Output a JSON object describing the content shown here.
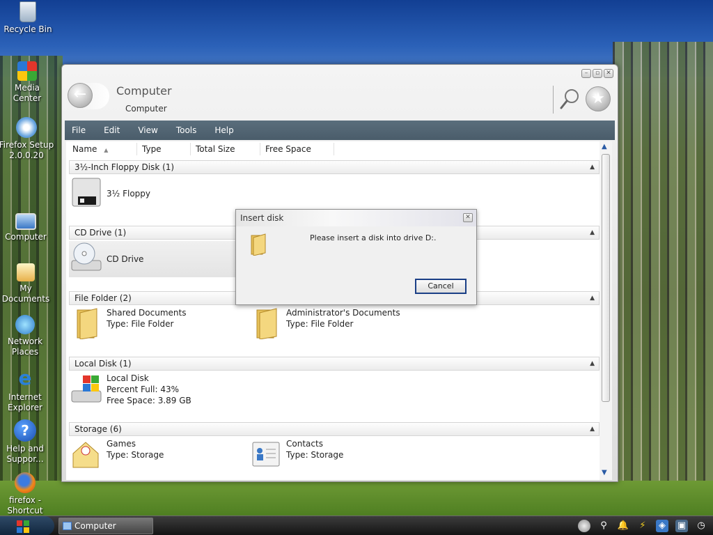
{
  "desktop": {
    "icons": [
      {
        "label": "Recycle Bin",
        "icon": "recycle-bin-icon"
      },
      {
        "label": "Media Center",
        "icon": "media-center-icon"
      },
      {
        "label": "Firefox Setup 2.0.0.20",
        "icon": "firefox-setup-icon"
      },
      {
        "label": "Computer",
        "icon": "computer-icon"
      },
      {
        "label": "My Documents",
        "icon": "my-documents-icon"
      },
      {
        "label": "Network Places",
        "icon": "network-places-icon"
      },
      {
        "label": "Internet Explorer",
        "icon": "internet-explorer-icon"
      },
      {
        "label": "Help and Suppor...",
        "icon": "help-support-icon"
      },
      {
        "label": "firefox - Shortcut",
        "icon": "firefox-shortcut-icon"
      }
    ]
  },
  "window": {
    "title": "Computer",
    "breadcrumb": "Computer",
    "menu": [
      "File",
      "Edit",
      "View",
      "Tools",
      "Help"
    ],
    "columns": [
      "Name",
      "Type",
      "Total Size",
      "Free Space"
    ],
    "groups": [
      {
        "header": "3½-Inch Floppy Disk (1)",
        "items": [
          {
            "lines": [
              "3½ Floppy"
            ]
          }
        ]
      },
      {
        "header": "CD Drive (1)",
        "items": [
          {
            "lines": [
              "CD Drive"
            ]
          }
        ]
      },
      {
        "header": "File Folder (2)",
        "items": [
          {
            "lines": [
              "Shared Documents",
              "Type: File Folder"
            ]
          },
          {
            "lines": [
              "Administrator's Documents",
              "Type: File Folder"
            ]
          }
        ]
      },
      {
        "header": "Local Disk (1)",
        "items": [
          {
            "lines": [
              "Local Disk",
              "Percent Full: 43%",
              "Free Space: 3.89 GB"
            ]
          }
        ]
      },
      {
        "header": "Storage (6)",
        "items": [
          {
            "lines": [
              "Games",
              "Type: Storage"
            ]
          },
          {
            "lines": [
              "Contacts",
              "Type: Storage"
            ]
          }
        ]
      }
    ]
  },
  "dialog": {
    "title": "Insert disk",
    "message": "Please insert a disk into drive D:.",
    "cancel_label": "Cancel"
  },
  "taskbar": {
    "active_task": "Computer"
  },
  "colors": {
    "menubar": "#4f6270",
    "accent": "#1a3f86"
  }
}
